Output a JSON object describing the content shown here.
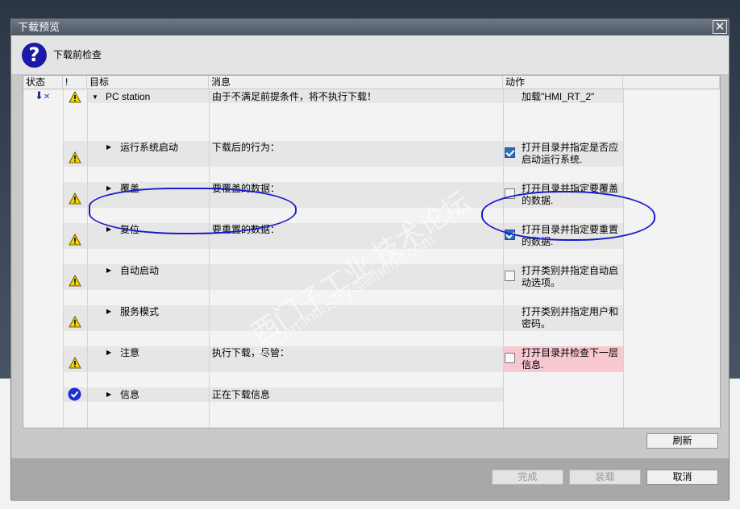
{
  "dialog": {
    "title": "下载预览",
    "close_label": "✕",
    "header_title": "下载前检查"
  },
  "columns": {
    "status": "状态",
    "bang": "!",
    "target": "目标",
    "message": "消息",
    "action": "动作"
  },
  "rows": [
    {
      "target": "PC station",
      "message": "由于不满足前提条件，将不执行下载！",
      "action": "加载\"HMI_RT_2\"",
      "checkbox": "none",
      "expanded": true
    },
    {
      "target": "运行系统启动",
      "message": "下载后的行为：",
      "action": "打开目录并指定是否应启动运行系统.",
      "checkbox": "checked"
    },
    {
      "target": "覆盖",
      "message": "要覆盖的数据：",
      "action": "打开目录并指定要覆盖的数据.",
      "checkbox": "unchecked"
    },
    {
      "target": "复位",
      "message": "要重置的数据：",
      "action": "打开目录并指定要重置的数据.",
      "checkbox": "checked"
    },
    {
      "target": "自动启动",
      "message": "",
      "action": "打开类别并指定自动启动选项。",
      "checkbox": "unchecked"
    },
    {
      "target": "服务模式",
      "message": "",
      "action": "打开类别并指定用户和密码。",
      "checkbox": "none"
    },
    {
      "target": "注意",
      "message": "执行下载，尽管：",
      "action": "打开目录并检查下一层信息.",
      "checkbox": "unchecked"
    },
    {
      "target": "信息",
      "message": "正在下载信息",
      "action": "",
      "checkbox": "none"
    }
  ],
  "buttons": {
    "refresh": "刷新",
    "finish": "完成",
    "load": "装载",
    "cancel": "取消"
  },
  "watermark": {
    "line1": "西门子工业 技术论坛",
    "line2": "support.industry.siemens.com"
  },
  "colors": {
    "warning": "#f5d400",
    "info": "#1b2fd0",
    "error_highlight": "#f7c8d0",
    "checkbox_checked": "#2e6ebd"
  }
}
